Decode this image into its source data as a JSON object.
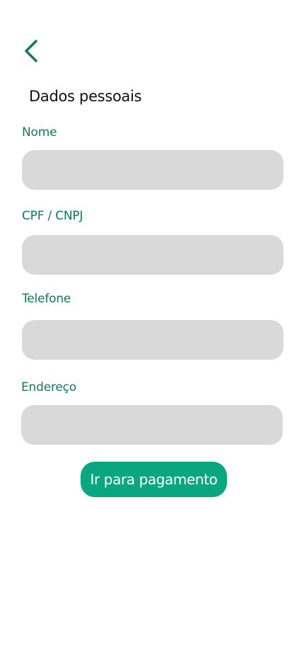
{
  "header": {
    "back_icon": "chevron-left-icon",
    "title": "Dados pessoais"
  },
  "form": {
    "fields": [
      {
        "label": "Nome",
        "value": "",
        "placeholder": ""
      },
      {
        "label": "CPF / CNPJ",
        "value": "",
        "placeholder": ""
      },
      {
        "label": "Telefone",
        "value": "",
        "placeholder": ""
      },
      {
        "label": "Endereço",
        "value": "",
        "placeholder": ""
      }
    ],
    "submit_label": "Ir para pagamento"
  },
  "colors": {
    "accent": "#0f7a5e",
    "button": "#0aa680",
    "input_background": "#d9d9d9",
    "title_text": "#111111",
    "button_text": "#ffffff"
  }
}
